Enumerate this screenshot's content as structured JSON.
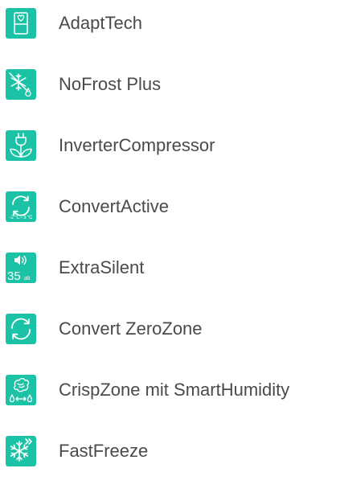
{
  "colors": {
    "accent": "#1cc2a6",
    "label_text": "#4a4a4a",
    "icon_foreground": "#ffffff"
  },
  "features": [
    {
      "label": "AdaptTech",
      "icon": "fridge-heart-icon"
    },
    {
      "label": "NoFrost Plus",
      "icon": "snowflake-drop-icon"
    },
    {
      "label": "InverterCompressor",
      "icon": "plug-leaf-icon"
    },
    {
      "label": "ConvertActive",
      "icon": "convert-arrows-icon",
      "icon_caption": "-2 °C - 3 °C"
    },
    {
      "label": "ExtraSilent",
      "icon": "speaker-sound-icon",
      "icon_value": "35",
      "icon_unit": "dB"
    },
    {
      "label": "Convert ZeroZone",
      "icon": "convert-arrows-icon"
    },
    {
      "label": "CrispZone mit SmartHumidity",
      "icon": "vegetable-humidity-icon"
    },
    {
      "label": "FastFreeze",
      "icon": "snowflake-fast-icon"
    }
  ]
}
